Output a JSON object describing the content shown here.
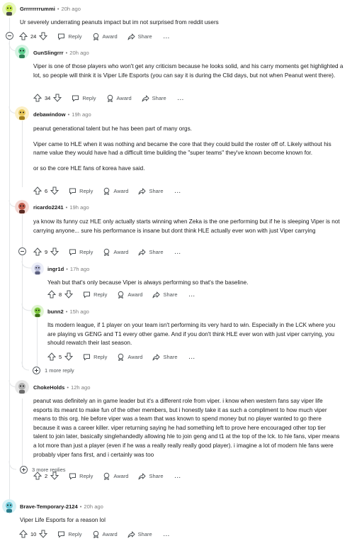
{
  "labels": {
    "reply": "Reply",
    "award": "Award",
    "share": "Share",
    "more_menu": "..."
  },
  "comments": [
    {
      "user": "Grrrrrrrrummi",
      "sep": "•",
      "time": "20h ago",
      "paragraphs": [
        "Ur severely underrating peanuts impact but im not surprised from reddit users"
      ],
      "votes": "24",
      "avatar_color": "#c5e84a"
    },
    {
      "user": "GunSlingrrr",
      "sep": "•",
      "time": "20h ago",
      "paragraphs": [
        "Viper is one of those players who won't get any criticism because he looks solid, and his carry moments get highlighted a lot, so people will think it is Viper Life Esports (you can say it is during the Clid days, but not when Peanut went there)."
      ],
      "votes": "34",
      "avatar_color": "#5ccf8e"
    },
    {
      "user": "debawindow",
      "sep": "•",
      "time": "19h ago",
      "paragraphs": [
        "peanut generational talent but he has been part of many orgs.",
        "Viper came to HLE when it was nothing and became the core that they could build the roster off of. Likely without his name value they would have had a difficult time building the \"super teams\" they've known become known for.",
        "or so the core HLE fans of korea have said."
      ],
      "votes": "6",
      "avatar_color": "#e8c85a"
    },
    {
      "user": "ricardo2241",
      "sep": "•",
      "time": "19h ago",
      "paragraphs": [
        "ya know its funny cuz HLE only actually starts winning when Zeka is the one performing but if he is sleeping Viper is not carrying anyone... sure his performance is insane but dont think HLE actually ever won with just Viper carrying"
      ],
      "votes": "9",
      "avatar_color": "#c05a4a"
    },
    {
      "user": "ingr1d",
      "sep": "•",
      "time": "17h ago",
      "paragraphs": [
        "Yeah but that's only because Viper is always performing so that's the baseline."
      ],
      "votes": "8",
      "avatar_color": "#b8bcd8"
    },
    {
      "user": "bunn2",
      "sep": "•",
      "time": "15h ago",
      "paragraphs": [
        "Its modern league, if 1 player on your team isn't performing its very hard to win. Especially in the LCK where you are playing vs GENG and T1 every other game. And if you don't think HLE ever won with just viper carrying, you should rewatch their last season."
      ],
      "votes": "5",
      "avatar_color": "#7cc83a"
    },
    {
      "user": "ChokeHolds",
      "sep": "•",
      "time": "12h ago",
      "paragraphs": [
        "peanut was definitely an in game leader but it's a different role from viper. i know when western fans say viper life esports its meant to make fun of the other members, but i honestly take it as such a compliment to how much viper means to this org. hle before viper was a team that was known to spend money but no player wanted to go there because it was a career killer. viper returning saying he had something left to prove here encouraged other top tier talent to join later, basically singlehandedly allowing hle to join geng and t1 at the top of the lck. to hle fans, viper means a lot more than just a player (even if he was a really really really good player). i imagine a lot of modern hle fans were probably viper fans first, and i certainly was too"
      ],
      "votes": "2",
      "avatar_color": "#b0b0b0"
    },
    {
      "user": "Brave-Temporary-2124",
      "sep": "•",
      "time": "20h ago",
      "paragraphs": [
        "Viper Life Esports for a reason lol"
      ],
      "votes": "10",
      "avatar_color": "#6cc8d8"
    }
  ],
  "more_replies_1": "1 more reply",
  "more_replies_3": "3 more replies"
}
